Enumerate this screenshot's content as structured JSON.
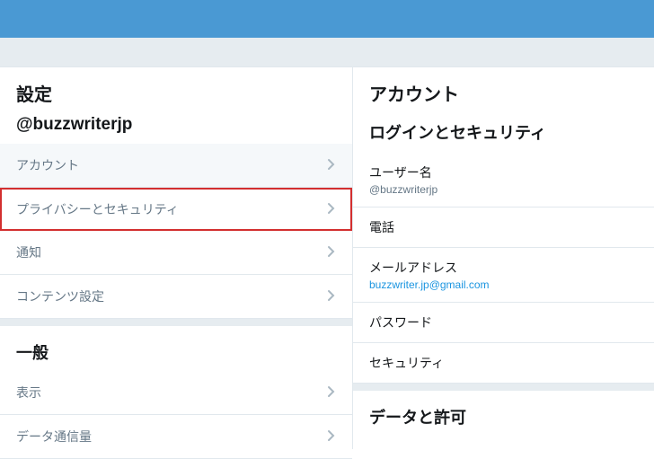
{
  "left": {
    "title": "設定",
    "username": "@buzzwriterjp",
    "items": [
      {
        "label": "アカウント",
        "state": "active"
      },
      {
        "label": "プライバシーとセキュリティ",
        "state": "highlighted"
      },
      {
        "label": "通知",
        "state": ""
      },
      {
        "label": "コンテンツ設定",
        "state": ""
      }
    ],
    "general_header": "一般",
    "general_items": [
      {
        "label": "表示"
      },
      {
        "label": "データ通信量"
      }
    ]
  },
  "right": {
    "title": "アカウント",
    "login_security_header": "ログインとセキュリティ",
    "items": [
      {
        "label": "ユーザー名",
        "value": "@buzzwriterjp",
        "value_style": ""
      },
      {
        "label": "電話",
        "value": ""
      },
      {
        "label": "メールアドレス",
        "value": "buzzwriter.jp@gmail.com",
        "value_style": "link"
      },
      {
        "label": "パスワード",
        "value": ""
      },
      {
        "label": "セキュリティ",
        "value": ""
      }
    ],
    "data_permission_header": "データと許可"
  }
}
